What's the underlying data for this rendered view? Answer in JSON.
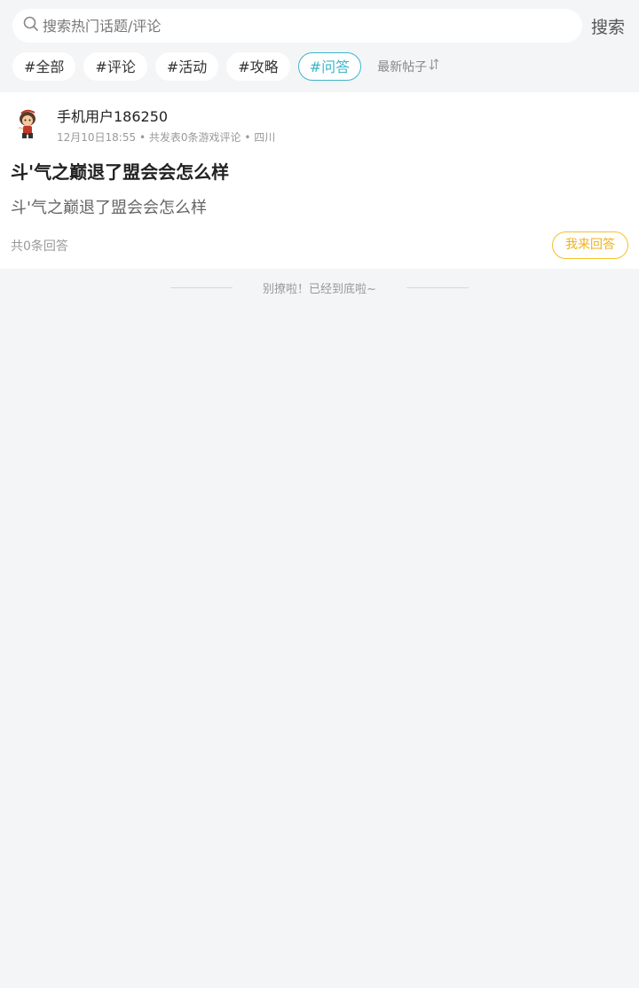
{
  "search": {
    "placeholder": "搜索热门话题/评论",
    "value": "",
    "button_label": "搜索"
  },
  "tags": [
    {
      "label": "#全部",
      "active": false
    },
    {
      "label": "#评论",
      "active": false
    },
    {
      "label": "#活动",
      "active": false
    },
    {
      "label": "#攻略",
      "active": false
    },
    {
      "label": "#问答",
      "active": true
    }
  ],
  "sort": {
    "label": "最新帖子",
    "icon": "sort-arrows-icon"
  },
  "post": {
    "username": "手机用户186250",
    "date": "12月10日18:55",
    "stats": "共发表0条游戏评论",
    "location": "四川",
    "separator": "•",
    "title": "斗'气之巅退了盟会会怎么样",
    "body": "斗'气之巅退了盟会会怎么样",
    "answer_count": "共0条回答",
    "answer_button": "我来回答"
  },
  "footer": {
    "end_text": "别撩啦！已经到底啦~"
  },
  "colors": {
    "background": "#f4f5f7",
    "active_tag": "#3db6c8",
    "answer_button": "#efb21a"
  }
}
